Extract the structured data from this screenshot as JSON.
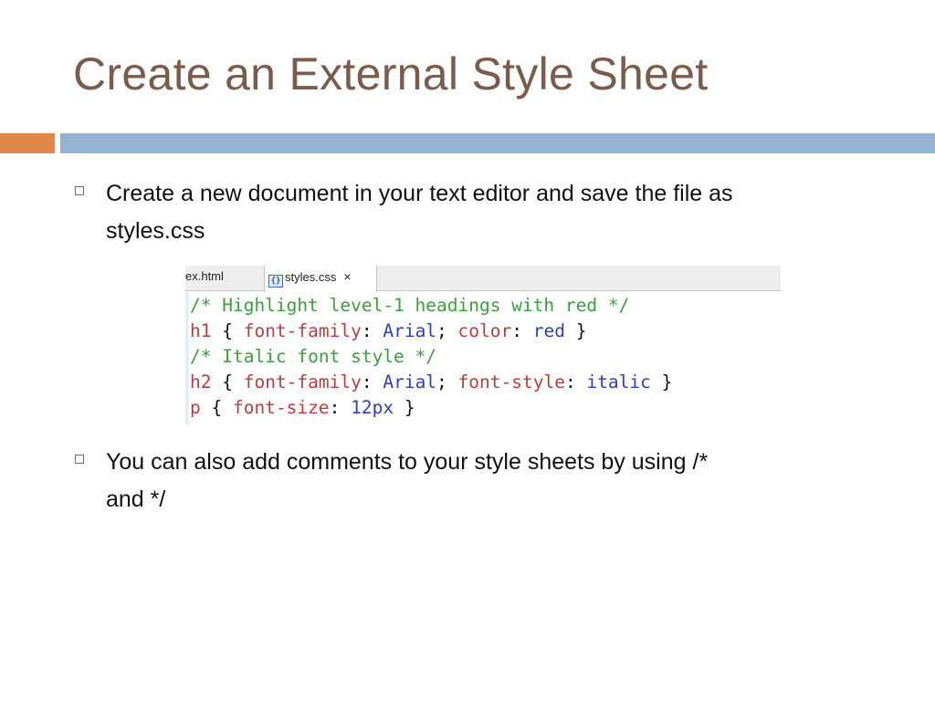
{
  "slide": {
    "title": "Create an External Style Sheet",
    "bullets": [
      {
        "lines": [
          "Create a new document in your text editor and save the file as",
          "styles.css"
        ]
      },
      {
        "lines": [
          "You can also add comments to your style sheets by using /*",
          "and */"
        ]
      }
    ]
  },
  "editor": {
    "tabs": [
      {
        "label": "ex.html",
        "active": false
      },
      {
        "label": "styles.css",
        "active": true,
        "icon": "css-file-icon",
        "close_glyph": "×"
      }
    ],
    "code_lines": [
      [
        {
          "t": "/* Highlight level-1 headings with red */",
          "k": "comment"
        }
      ],
      [
        {
          "t": "h1",
          "k": "sel"
        },
        {
          "t": " { ",
          "k": "punc"
        },
        {
          "t": "font-family",
          "k": "prop"
        },
        {
          "t": ": ",
          "k": "punc"
        },
        {
          "t": "Arial",
          "k": "val"
        },
        {
          "t": "; ",
          "k": "punc"
        },
        {
          "t": "color",
          "k": "prop"
        },
        {
          "t": ": ",
          "k": "punc"
        },
        {
          "t": "red",
          "k": "val"
        },
        {
          "t": " }",
          "k": "punc"
        }
      ],
      [
        {
          "t": "/* Italic font style */",
          "k": "comment"
        }
      ],
      [
        {
          "t": "h2",
          "k": "sel"
        },
        {
          "t": " { ",
          "k": "punc"
        },
        {
          "t": "font-family",
          "k": "prop"
        },
        {
          "t": ": ",
          "k": "punc"
        },
        {
          "t": "Arial",
          "k": "val"
        },
        {
          "t": "; ",
          "k": "punc"
        },
        {
          "t": "font-style",
          "k": "prop"
        },
        {
          "t": ": ",
          "k": "punc"
        },
        {
          "t": "italic",
          "k": "val"
        },
        {
          "t": " }",
          "k": "punc"
        }
      ],
      [
        {
          "t": "p",
          "k": "sel"
        },
        {
          "t": " { ",
          "k": "punc"
        },
        {
          "t": "font-size",
          "k": "prop"
        },
        {
          "t": ": ",
          "k": "punc"
        },
        {
          "t": "12px",
          "k": "val"
        },
        {
          "t": " }",
          "k": "punc"
        }
      ]
    ]
  },
  "colors": {
    "title": "#7a5c4c",
    "accent_orange": "#e0884a",
    "accent_blue": "#93b3d1",
    "comment": "#3aa13a",
    "selector_property": "#c23b3b",
    "value": "#2a3fc8"
  }
}
